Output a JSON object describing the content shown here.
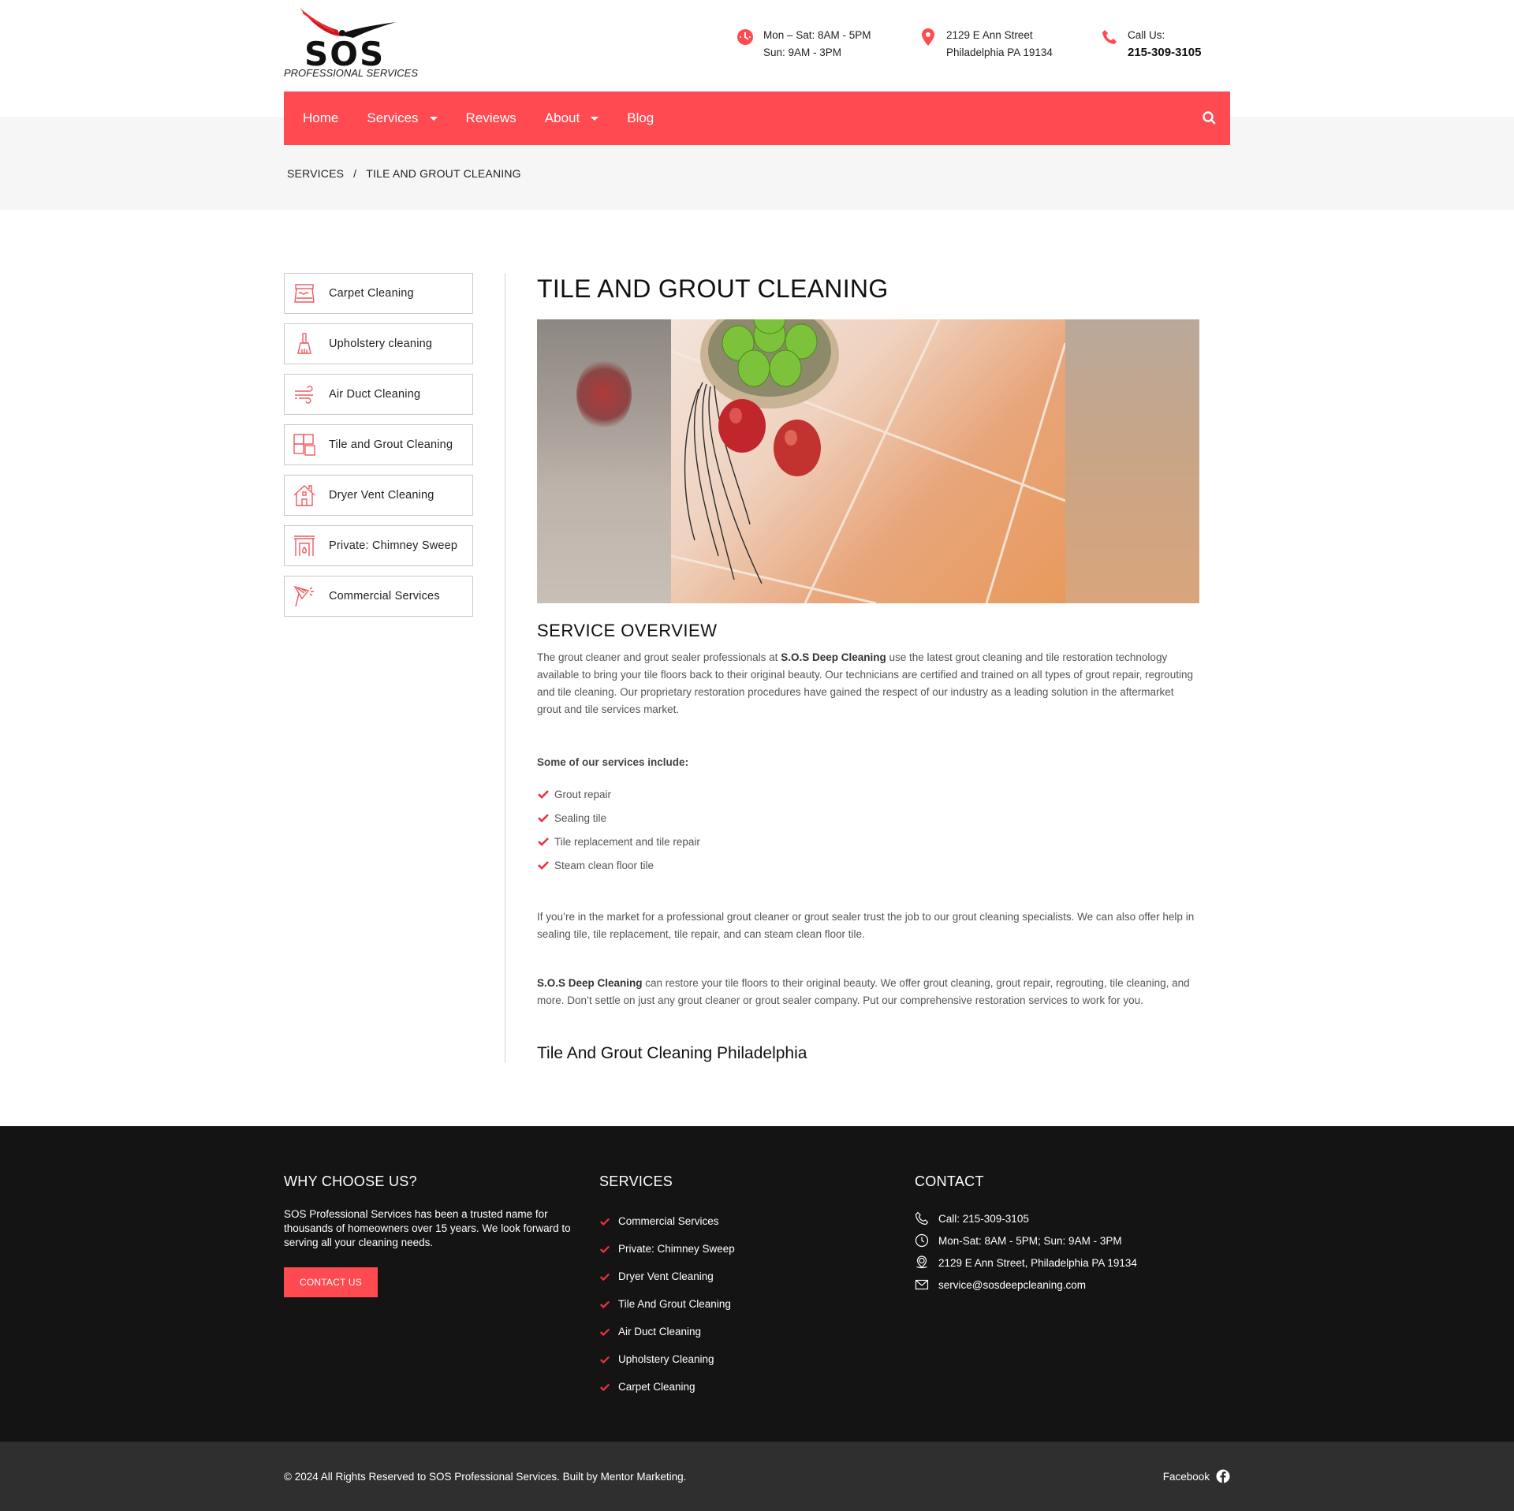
{
  "brand": {
    "logo_text": "SOS",
    "logo_subtitle": "PROFESSIONAL SERVICES",
    "accent": "#ff4a51",
    "dark": "#141414"
  },
  "header": {
    "hours": {
      "icon": "clock-icon",
      "line1": "Mon – Sat: 8AM - 5PM",
      "line2": "Sun: 9AM - 3PM"
    },
    "address": {
      "icon": "map-pin-icon",
      "line1": "2129 E Ann Street",
      "line2": "Philadelphia PA 19134"
    },
    "phone": {
      "icon": "phone-icon",
      "label": "Call Us:",
      "number": "215-309-3105"
    }
  },
  "nav": {
    "items": [
      {
        "label": "Home",
        "dropdown": false
      },
      {
        "label": "Services",
        "dropdown": true
      },
      {
        "label": "Reviews",
        "dropdown": false
      },
      {
        "label": "About",
        "dropdown": true
      },
      {
        "label": "Blog",
        "dropdown": false
      }
    ],
    "search_icon": "search-icon"
  },
  "breadcrumb": {
    "items": [
      "SERVICES",
      "TILE AND GROUT CLEANING"
    ],
    "separator": "/"
  },
  "sidebar": {
    "items": [
      {
        "label": "Carpet Cleaning",
        "icon": "carpet-icon"
      },
      {
        "label": "Upholstery cleaning",
        "icon": "brush-icon"
      },
      {
        "label": "Air Duct Cleaning",
        "icon": "air-flow-icon"
      },
      {
        "label": "Tile and Grout Cleaning",
        "icon": "tiles-icon"
      },
      {
        "label": "Dryer Vent Cleaning",
        "icon": "house-icon"
      },
      {
        "label": "Private: Chimney Sweep",
        "icon": "fireplace-icon"
      },
      {
        "label": "Commercial Services",
        "icon": "duster-icon"
      }
    ]
  },
  "main": {
    "title": "TILE AND GROUT CLEANING",
    "image_alt": "Tiled floor with bowl of green apples and red apples",
    "overview_heading": "SERVICE OVERVIEW",
    "overview": {
      "pre": "The grout cleaner and grout sealer professionals at ",
      "bold": "S.O.S Deep Cleaning",
      "post": " use the latest grout cleaning and tile restoration technology available to bring your tile floors back to their original beauty. Our technicians are certified and trained on all types of grout repair, regrouting and tile cleaning. Our proprietary restoration procedures have gained the respect of our industry as a leading solution in the aftermarket grout and tile services market."
    },
    "services_heading": "Some of our services include:",
    "services": [
      "Grout repair",
      "Sealing tile",
      "Tile replacement and tile repair",
      "Steam clean floor tile"
    ],
    "paragraph2": "If you’re in the market for a professional grout cleaner or grout sealer trust the job to our grout cleaning specialists. We can also offer help in sealing tile, tile replacement, tile repair, and can steam clean floor tile.",
    "paragraph3": {
      "bold": "S.O.S Deep Cleaning",
      "post": " can restore your tile floors to their original beauty. We offer grout cleaning, grout repair, regrouting, tile cleaning, and more. Don’t settle on just any grout cleaner or grout sealer company. Put our comprehensive restoration services to work for you."
    },
    "subheading": "Tile And Grout Cleaning Philadelphia"
  },
  "footer": {
    "why": {
      "heading": "WHY CHOOSE US?",
      "text": "SOS Professional Services has been a trusted name for thousands of homeowners over 15 years. We look forward to serving all your cleaning needs.",
      "button": "CONTACT US"
    },
    "services": {
      "heading": "SERVICES",
      "items": [
        "Commercial Services",
        "Private: Chimney Sweep",
        "Dryer Vent Cleaning",
        "Tile And Grout Cleaning",
        "Air Duct Cleaning",
        "Upholstery Cleaning",
        "Carpet Cleaning"
      ]
    },
    "contact": {
      "heading": "CONTACT",
      "items": [
        {
          "icon": "phone-icon",
          "text": "Call: 215-309-3105"
        },
        {
          "icon": "clock-icon",
          "text": "Mon-Sat: 8AM - 5PM; Sun: 9AM - 3PM"
        },
        {
          "icon": "map-pin-icon",
          "text": "2129 E Ann Street, Philadelphia PA 19134"
        },
        {
          "icon": "mail-icon",
          "text": "service@sosdeepcleaning.com"
        }
      ]
    },
    "copyright": "© 2024 All Rights Reserved to SOS Professional Services. Built by Mentor Marketing.",
    "social": {
      "label": "Facebook",
      "icon": "facebook-icon"
    }
  }
}
